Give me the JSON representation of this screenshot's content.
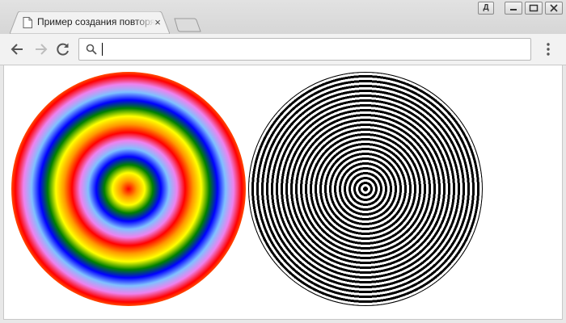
{
  "window": {
    "controls": {
      "profile_label": "Д",
      "minimize_label": "—",
      "maximize_label": "□",
      "close_label": "✕"
    }
  },
  "tab": {
    "title": "Пример создания повторяющегося радиального градиента",
    "close_label": "×"
  },
  "toolbar": {
    "address_value": "",
    "address_placeholder": ""
  },
  "content": {
    "gradients": [
      {
        "name": "rainbow-repeating-radial",
        "colors": [
          "#ff0000",
          "#ff9900",
          "#ffff00",
          "#008000",
          "#0000ff",
          "#80c0ff",
          "#ee82ee"
        ]
      },
      {
        "name": "black-white-repeating-radial",
        "colors": [
          "#000000",
          "#ffffff"
        ]
      }
    ]
  }
}
